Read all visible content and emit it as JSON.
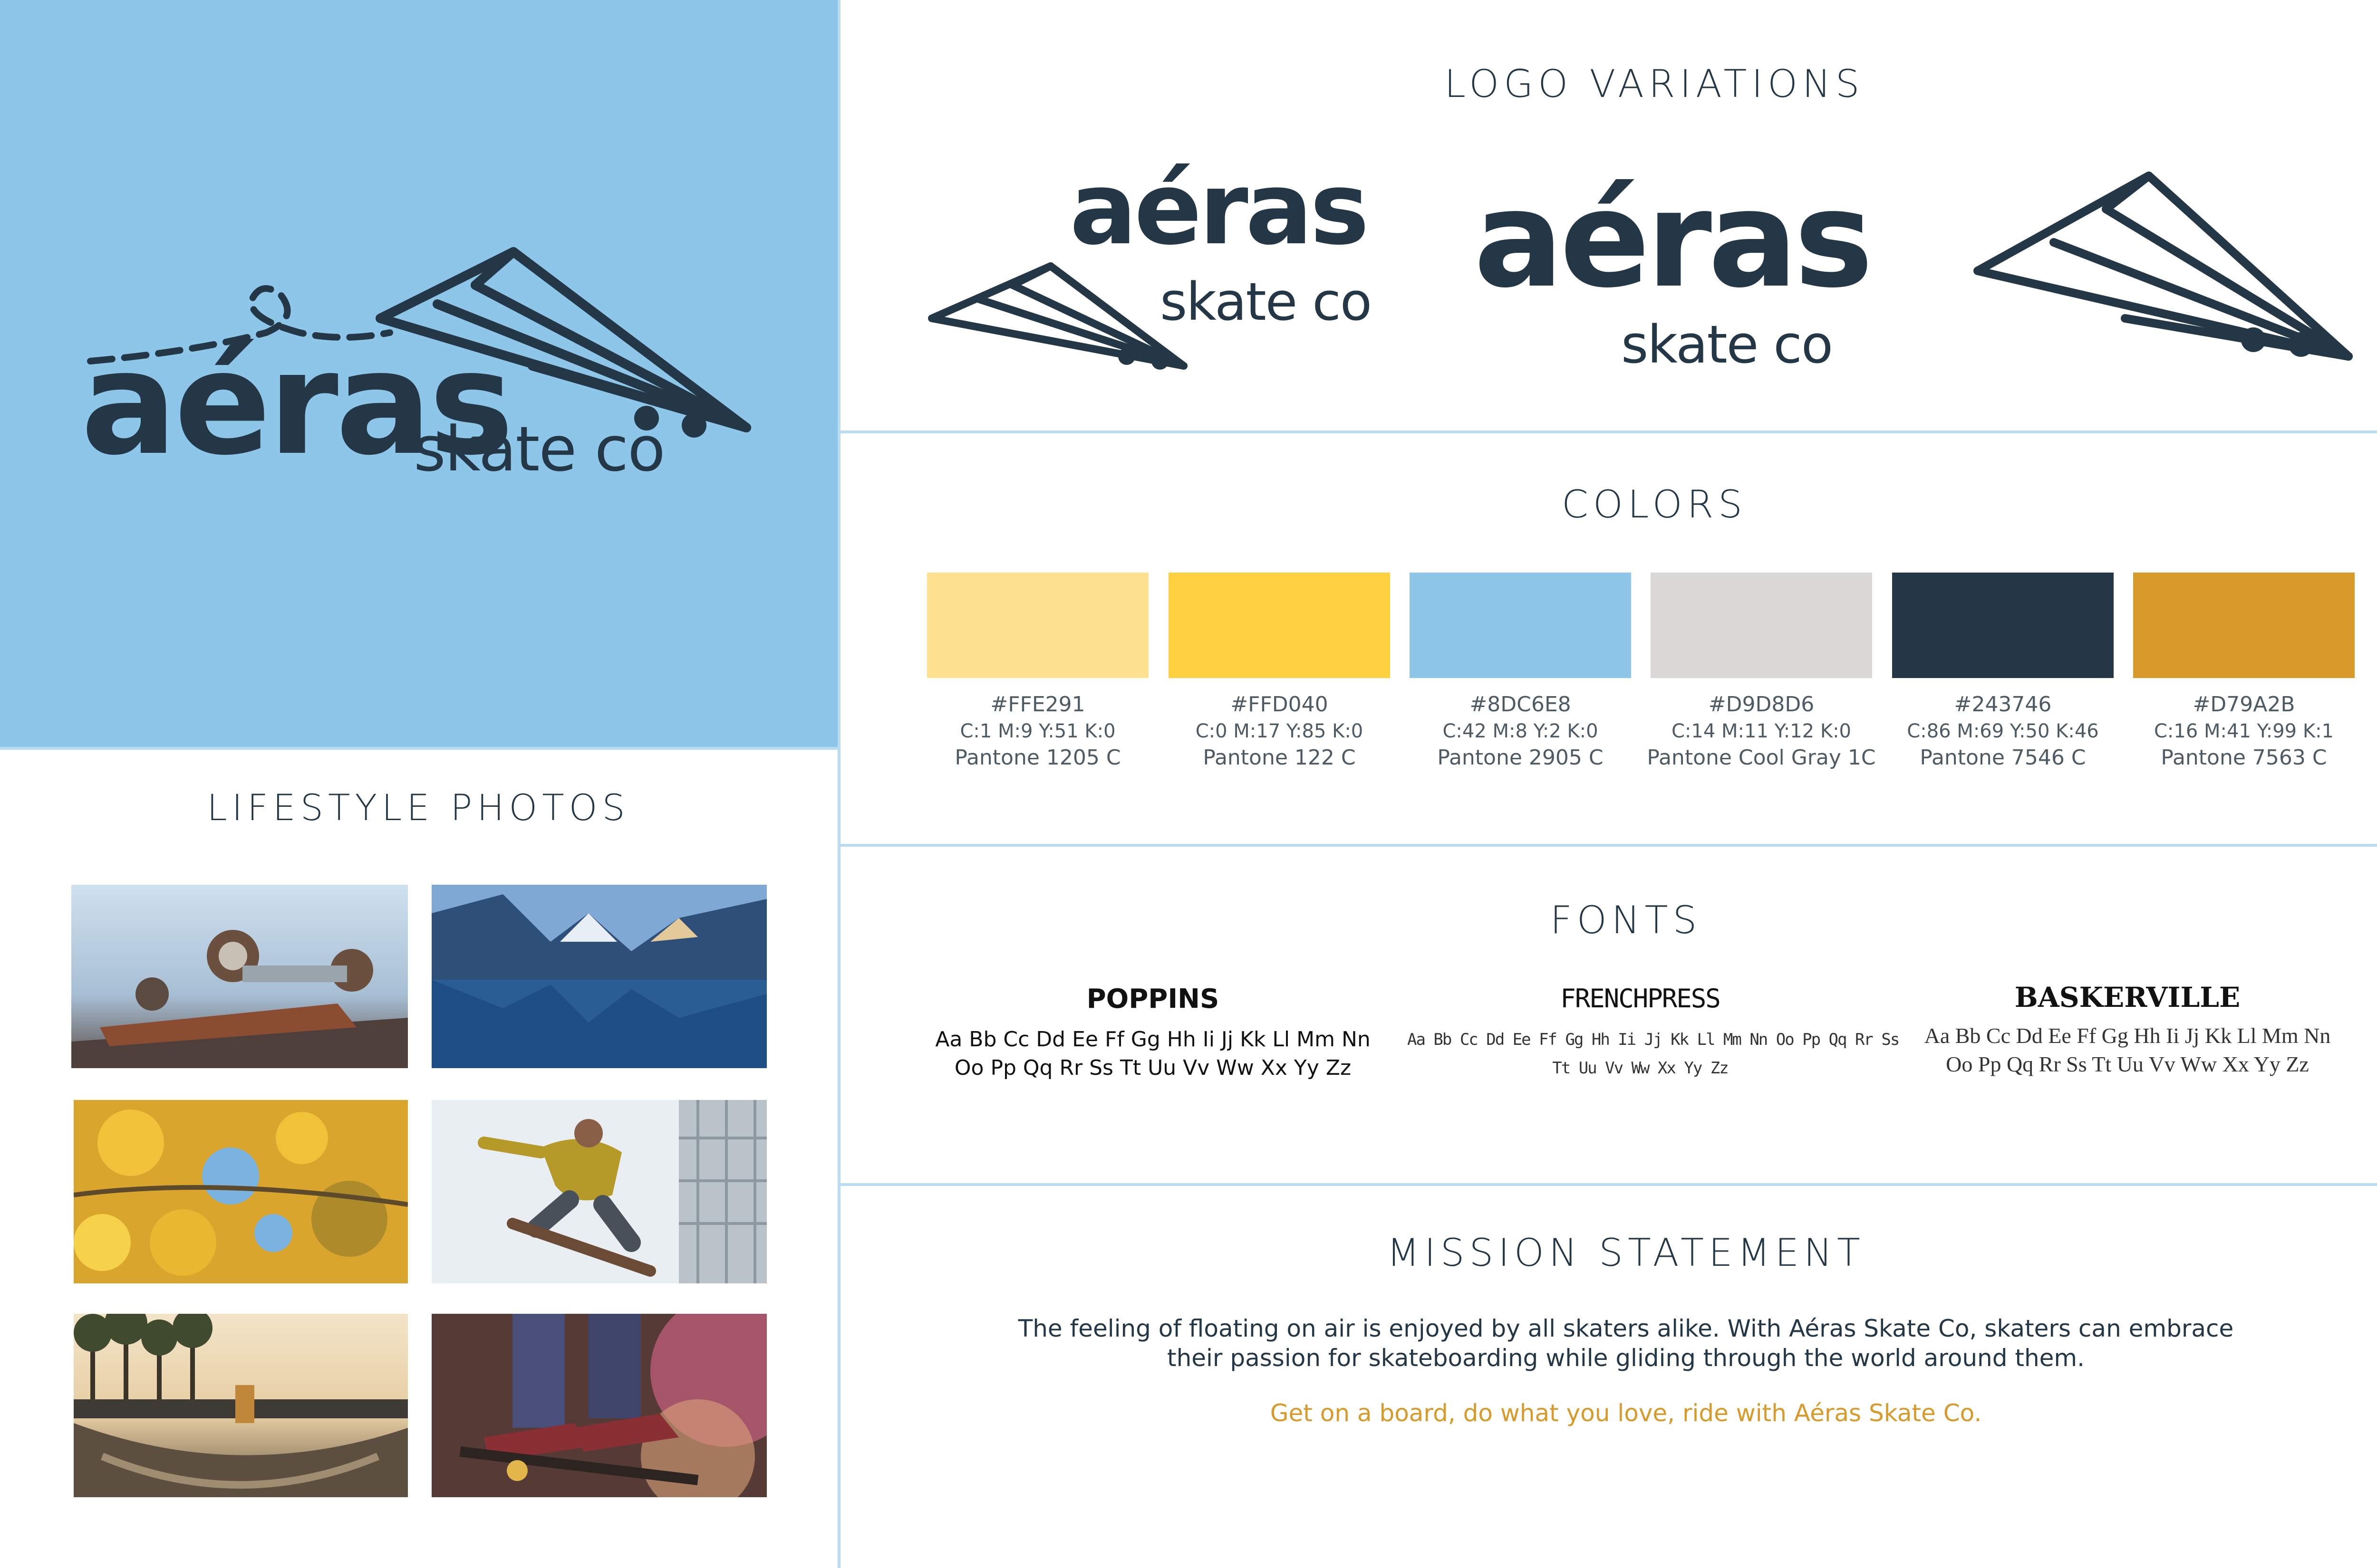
{
  "brand": {
    "wordmark": "aéras",
    "sub": "skate co",
    "colors": {
      "navy": "#243746",
      "sky": "#8DC6E8"
    }
  },
  "sections": {
    "logo_title": "LOGO VARIATIONS",
    "colors_title": "COLORS",
    "fonts_title": "FONTS",
    "mission_title": "MISSION STATEMENT",
    "lifestyle_title": "LIFESTYLE PHOTOS"
  },
  "swatches": [
    {
      "color": "#FFE291",
      "hex": "#FFE291",
      "cmyk": "C:1 M:9 Y:51 K:0",
      "pantone": "Pantone 1205 C"
    },
    {
      "color": "#FFD040",
      "hex": "#FFD040",
      "cmyk": "C:0 M:17 Y:85 K:0",
      "pantone": "Pantone 122 C"
    },
    {
      "color": "#8DC6E8",
      "hex": "#8DC6E8",
      "cmyk": "C:42 M:8 Y:2 K:0",
      "pantone": "Pantone 2905 C"
    },
    {
      "color": "#D9D8D6",
      "hex": "#D9D8D6",
      "cmyk": "C:14 M:11 Y:12 K:0",
      "pantone": "Pantone Cool Gray 1C"
    },
    {
      "color": "#243746",
      "hex": "#243746",
      "cmyk": "C:86 M:69 Y:50 K:46",
      "pantone": "Pantone 7546 C"
    },
    {
      "color": "#D79A2B",
      "hex": "#D79A2B",
      "cmyk": "C:16 M:41 Y:99 K:1",
      "pantone": "Pantone 7563 C"
    }
  ],
  "fonts": [
    {
      "name": "POPPINS",
      "line1": "Aa Bb Cc Dd Ee Ff Gg Hh Ii Jj Kk Ll Mm Nn",
      "line2": "Oo Pp Qq Rr Ss Tt Uu Vv Ww Xx Yy Zz"
    },
    {
      "name": "FRENCHPRESS",
      "line1": "Aa Bb Cc Dd Ee Ff Gg Hh Ii Jj Kk Ll Mm Nn Oo Pp Qq Rr Ss",
      "line2": "Tt Uu Vv Ww Xx Yy Zz"
    },
    {
      "name": "BASKERVILLE",
      "line1": "Aa Bb Cc Dd Ee Ff Gg Hh Ii Jj Kk Ll Mm Nn",
      "line2": "Oo Pp Qq Rr Ss Tt Uu Vv Ww Xx Yy Zz"
    }
  ],
  "mission": {
    "line1": "The feeling of floating on air is enjoyed by all skaters alike. With Aéras Skate Co, skaters can embrace",
    "line2": "their passion for skateboarding while gliding through the world around them.",
    "tagline": "Get on a board, do what you love, ride with Aéras Skate Co."
  }
}
